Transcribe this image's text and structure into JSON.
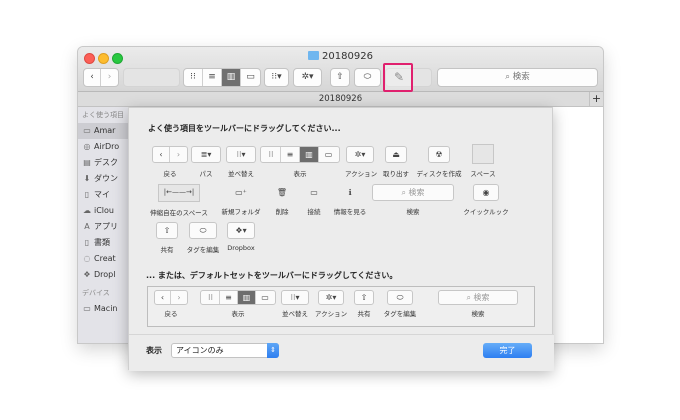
{
  "window": {
    "title": "20180926",
    "tab_title": "20180926",
    "tab_add": "+",
    "search_placeholder": "⌕ 検索"
  },
  "sidebar": {
    "favorites_header": "よく使う項目",
    "devices_header": "デバイス",
    "items": [
      {
        "label": "Amar",
        "icon": "home-icon",
        "glyph": "▭"
      },
      {
        "label": "AirDro",
        "icon": "airdrop-icon",
        "glyph": "◎"
      },
      {
        "label": "デスク",
        "icon": "desktop-icon",
        "glyph": "▤"
      },
      {
        "label": "ダウン",
        "icon": "download-icon",
        "glyph": "⬇"
      },
      {
        "label": "マイ",
        "icon": "documents-icon",
        "glyph": "▯"
      },
      {
        "label": "iClou",
        "icon": "cloud-icon",
        "glyph": "☁"
      },
      {
        "label": "アプリ",
        "icon": "applications-icon",
        "glyph": "A"
      },
      {
        "label": "書類",
        "icon": "document-icon",
        "glyph": "▯"
      },
      {
        "label": "Creat",
        "icon": "creative-cloud-icon",
        "glyph": "◌"
      },
      {
        "label": "Dropl",
        "icon": "dropbox-icon",
        "glyph": "❖"
      }
    ],
    "device_item": "Macin"
  },
  "sheet": {
    "heading_custom": "よく使う項目をツールバーにドラッグしてください...",
    "heading_default": "... または、デフォルトセットをツールバーにドラッグしてください。",
    "items": {
      "back": "戻る",
      "path": "パス",
      "arrange": "並べ替え",
      "view": "表示",
      "action": "アクション",
      "eject": "取り出す",
      "burn": "ディスクを作成",
      "space": "スペース",
      "flexible_space": "伸縮自在のスペース",
      "new_folder": "新規フォルダ",
      "delete": "削除",
      "connect": "接続",
      "get_info": "情報を見る",
      "search": "検索",
      "quick_look": "クイックルック",
      "share": "共有",
      "edit_tags": "タグを編集",
      "dropbox": "Dropbox"
    },
    "search_field": "⌕ 検索",
    "default_set": {
      "back": "戻る",
      "view": "表示",
      "arrange": "並べ替え",
      "action": "アクション",
      "share": "共有",
      "edit_tags": "タグを編集",
      "search": "検索",
      "search_field": "⌕ 検索"
    },
    "show_label": "表示",
    "show_value": "アイコンのみ",
    "done": "完了"
  },
  "colors": {
    "highlight": "#e0206e",
    "accent": "#2d7ef1",
    "folder": "#6fb6ef"
  }
}
